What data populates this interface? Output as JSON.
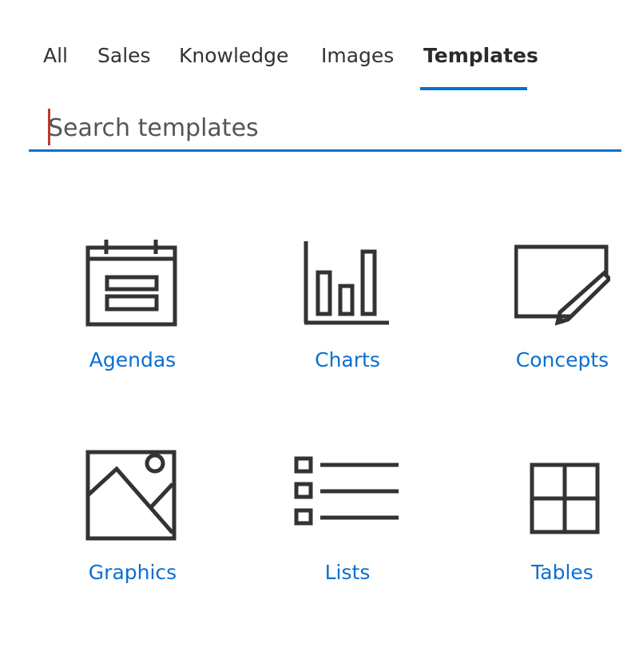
{
  "tabs": [
    {
      "label": "All"
    },
    {
      "label": "Sales"
    },
    {
      "label": "Knowledge"
    },
    {
      "label": "Images"
    },
    {
      "label": "Templates"
    }
  ],
  "active_tab": "Templates",
  "search": {
    "placeholder": "Search templates",
    "value": ""
  },
  "tiles": [
    {
      "label": "Agendas",
      "icon": "calendar-icon"
    },
    {
      "label": "Charts",
      "icon": "bar-chart-icon"
    },
    {
      "label": "Concepts",
      "icon": "pencil-edit-icon"
    },
    {
      "label": "Graphics",
      "icon": "image-icon"
    },
    {
      "label": "Lists",
      "icon": "list-icon"
    },
    {
      "label": "Tables",
      "icon": "table-icon"
    }
  ],
  "colors": {
    "accent": "#0a6fd1",
    "text": "#333333",
    "icon_stroke": "#333333",
    "caret": "#c0392b"
  }
}
